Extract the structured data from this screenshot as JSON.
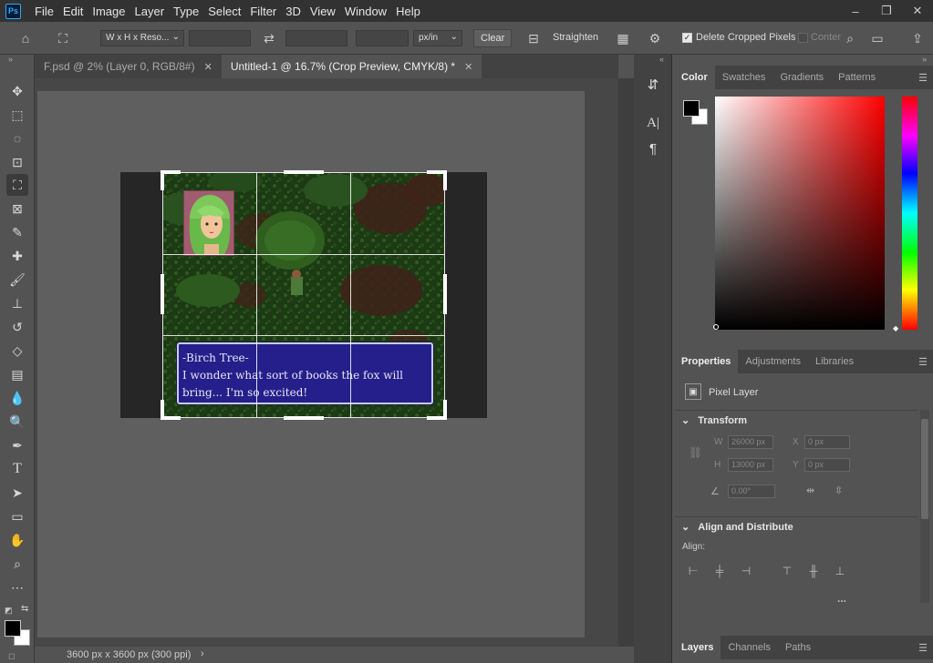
{
  "app": {
    "logo": "Ps"
  },
  "menu": [
    "File",
    "Edit",
    "Image",
    "Layer",
    "Type",
    "Select",
    "Filter",
    "3D",
    "View",
    "Window",
    "Help"
  ],
  "window_controls": {
    "minimize": "–",
    "restore": "❐",
    "close": "✕"
  },
  "options": {
    "ratio_label": "W x H x Reso...",
    "resolution_unit": "px/in",
    "clear_label": "Clear",
    "straighten_label": "Straighten",
    "delete_cropped_label": "Delete Cropped Pixels",
    "delete_cropped_checked": true,
    "content_aware_label": "Conter",
    "content_aware_checked": false
  },
  "tabs": [
    {
      "label": "F.psd @ 2% (Layer 0, RGB/8#)",
      "active": false
    },
    {
      "label": "Untitled-1 @ 16.7% (Crop Preview, CMYK/8) *",
      "active": true
    }
  ],
  "status": {
    "doc_size": "3600 px x 3600 px (300 ppi)"
  },
  "dialog": {
    "line1": "-Birch Tree-",
    "line2": "I wonder what sort of books the fox will",
    "line3": "bring... I'm so excited!"
  },
  "color_panel": {
    "tabs": [
      "Color",
      "Swatches",
      "Gradients",
      "Patterns"
    ],
    "active_tab": "Color",
    "foreground": "#000000",
    "background": "#ffffff",
    "hue": "#ff0000"
  },
  "properties_panel": {
    "tabs": [
      "Properties",
      "Adjustments",
      "Libraries"
    ],
    "active_tab": "Properties",
    "layer_type": "Pixel Layer",
    "transform_label": "Transform",
    "w_label": "W",
    "w_value": "26000 px",
    "h_label": "H",
    "h_value": "13000 px",
    "x_label": "X",
    "x_value": "0 px",
    "y_label": "Y",
    "y_value": "0 px",
    "angle_value": "0.00°",
    "align_label": "Align and Distribute",
    "align_sub": "Align:",
    "more": "..."
  },
  "layers_panel": {
    "tabs": [
      "Layers",
      "Channels",
      "Paths"
    ],
    "active_tab": "Layers"
  }
}
